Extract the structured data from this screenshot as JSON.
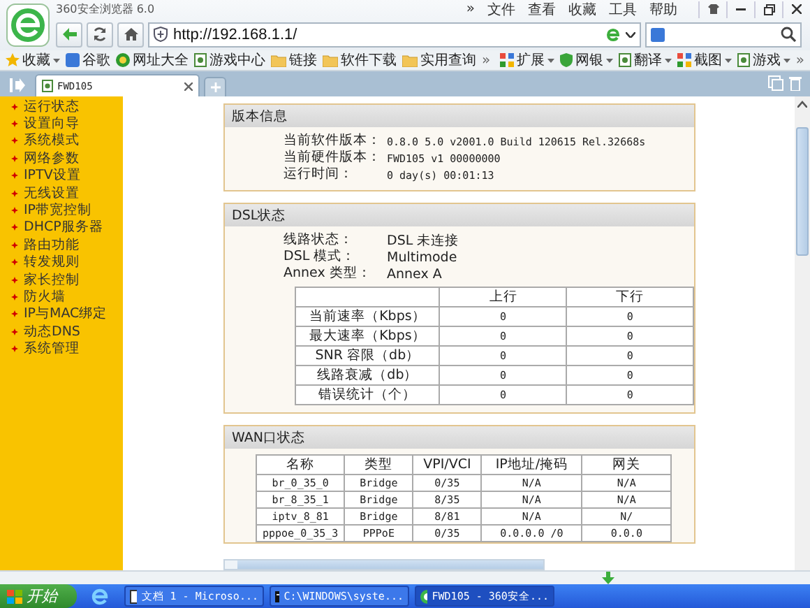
{
  "browser": {
    "title": "360安全浏览器 6.0",
    "menu": [
      "»",
      "文件",
      "查看",
      "收藏",
      "工具",
      "帮助"
    ],
    "address": "http://192.168.1.1/"
  },
  "bookmarks_left": [
    {
      "label": "收藏",
      "kind": "star",
      "dropdown": true
    },
    {
      "label": "谷歌",
      "kind": "letter",
      "dropdown": false
    },
    {
      "label": "网址大全",
      "kind": "globe",
      "dropdown": false
    },
    {
      "label": "游戏中心",
      "kind": "page",
      "dropdown": false
    },
    {
      "label": "链接",
      "kind": "folder",
      "dropdown": false
    },
    {
      "label": "软件下载",
      "kind": "folder",
      "dropdown": false
    },
    {
      "label": "实用查询",
      "kind": "folder",
      "dropdown": false
    }
  ],
  "bookmarks_more": "»",
  "bookmarks_right": [
    {
      "label": "扩展",
      "kind": "grid",
      "dropdown": true
    },
    {
      "label": "网银",
      "kind": "shield",
      "dropdown": true
    },
    {
      "label": "翻译",
      "kind": "page",
      "dropdown": true
    },
    {
      "label": "截图",
      "kind": "grid",
      "dropdown": true
    },
    {
      "label": "游戏",
      "kind": "page",
      "dropdown": true
    }
  ],
  "bookmarks_right_more": "»",
  "tabs": [
    {
      "label": "FWD105",
      "selected": true
    }
  ],
  "sidebar": {
    "items": [
      "运行状态",
      "设置向导",
      "系统模式",
      "网络参数",
      "IPTV设置",
      "无线设置",
      "IP带宽控制",
      "DHCP服务器",
      "路由功能",
      "转发规则",
      "家长控制",
      "防火墙",
      "IP与MAC绑定",
      "动态DNS",
      "系统管理"
    ]
  },
  "version_panel": {
    "title": "版本信息",
    "rows": [
      {
        "label": "当前软件版本：",
        "value": "0.8.0 5.0 v2001.0 Build 120615 Rel.32668s"
      },
      {
        "label": "当前硬件版本：",
        "value": "FWD105 v1 00000000"
      },
      {
        "label": "运行时间：",
        "value": "0 day(s) 00:01:13"
      }
    ]
  },
  "dsl_panel": {
    "title": "DSL状态",
    "rows": [
      {
        "label": "线路状态：",
        "value": "DSL 未连接"
      },
      {
        "label": "DSL 模式：",
        "value": "Multimode"
      },
      {
        "label": "Annex 类型：",
        "value": "Annex A"
      }
    ],
    "table": {
      "columns": [
        "上行",
        "下行"
      ],
      "rows": [
        {
          "label": "当前速率（Kbps）",
          "up": "0",
          "down": "0"
        },
        {
          "label": "最大速率（Kbps）",
          "up": "0",
          "down": "0"
        },
        {
          "label": "SNR 容限（db）",
          "up": "0",
          "down": "0"
        },
        {
          "label": "线路衰减（db）",
          "up": "0",
          "down": "0"
        },
        {
          "label": "错误统计（个）",
          "up": "0",
          "down": "0"
        }
      ]
    }
  },
  "wan_panel": {
    "title": "WAN口状态",
    "columns": [
      "名称",
      "类型",
      "VPI/VCI",
      "IP地址/掩码",
      "网关"
    ],
    "rows": [
      [
        "br_0_35_0",
        "Bridge",
        "0/35",
        "N/A",
        "N/A"
      ],
      [
        "br_8_35_1",
        "Bridge",
        "8/35",
        "N/A",
        "N/A"
      ],
      [
        "iptv_8_81",
        "Bridge",
        "8/81",
        "N/A",
        "N/"
      ],
      [
        "pppoe_0_35_3",
        "PPPoE",
        "0/35",
        "0.0.0.0 /0",
        "0.0.0"
      ]
    ]
  },
  "taskbar": {
    "start": "开始",
    "tasks": [
      {
        "label": "文档 1 - Microso...",
        "kind": "document",
        "selected": false
      },
      {
        "label": "C:\\WINDOWS\\syste...",
        "kind": "console",
        "selected": false
      },
      {
        "label": "FWD105 - 360安全...",
        "kind": "browser",
        "selected": true
      }
    ]
  }
}
